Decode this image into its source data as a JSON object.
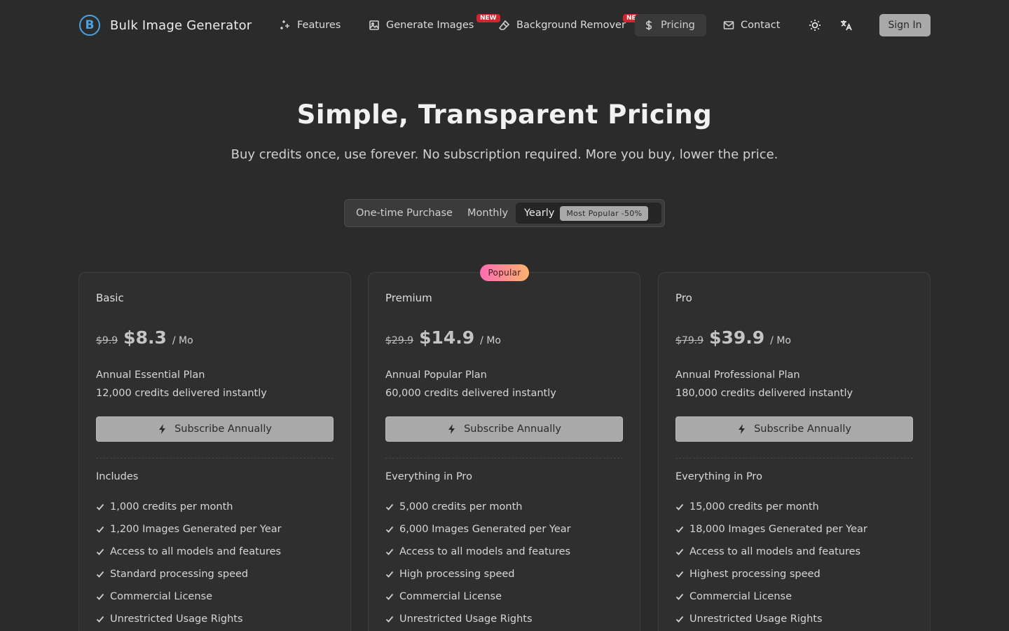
{
  "nav": {
    "brand_letter": "B",
    "brand_name": "Bulk Image Generator",
    "items": [
      {
        "label": "Features",
        "icon": "sparkles-icon"
      },
      {
        "label": "Generate Images",
        "icon": "image-icon",
        "badge": "NEW"
      },
      {
        "label": "Background Remover",
        "icon": "eraser-icon",
        "badge": "NEW"
      },
      {
        "label": "Pricing",
        "icon": "dollar-icon",
        "active": true
      },
      {
        "label": "Contact",
        "icon": "mail-icon"
      }
    ],
    "theme_icon": "sun-icon",
    "language_icon": "translate-icon",
    "signin_label": "Sign In"
  },
  "hero": {
    "title": "Simple, Transparent Pricing",
    "subtitle": "Buy credits once, use forever. No subscription required. More you buy, lower the price."
  },
  "billing_toggle": {
    "options": [
      "One-time Purchase",
      "Monthly",
      "Yearly"
    ],
    "selected": "Yearly",
    "yearly_badge": "Most Popular -50%"
  },
  "popular_label": "Popular",
  "plans": [
    {
      "name": "Basic",
      "old_price": "$9.9",
      "price": "$8.3",
      "per": "/ Mo",
      "description": "Annual Essential Plan",
      "credits": "12,000 credits delivered instantly",
      "cta": "Subscribe Annually",
      "features_heading": "Includes",
      "features": [
        "1,000 credits per month",
        "1,200 Images Generated per Year",
        "Access to all models and features",
        "Standard processing speed",
        "Commercial License",
        "Unrestricted Usage Rights"
      ]
    },
    {
      "name": "Premium",
      "old_price": "$29.9",
      "price": "$14.9",
      "per": "/ Mo",
      "description": "Annual Popular Plan",
      "credits": "60,000 credits delivered instantly",
      "cta": "Subscribe Annually",
      "features_heading": "Everything in Pro",
      "features": [
        "5,000 credits per month",
        "6,000 Images Generated per Year",
        "Access to all models and features",
        "High processing speed",
        "Commercial License",
        "Unrestricted Usage Rights"
      ]
    },
    {
      "name": "Pro",
      "old_price": "$79.9",
      "price": "$39.9",
      "per": "/ Mo",
      "description": "Annual Professional Plan",
      "credits": "180,000 credits delivered instantly",
      "cta": "Subscribe Annually",
      "features_heading": "Everything in Pro",
      "features": [
        "15,000 credits per month",
        "18,000 Images Generated per Year",
        "Access to all models and features",
        "Highest processing speed",
        "Commercial License",
        "Unrestricted Usage Rights"
      ]
    }
  ],
  "colors": {
    "background": "#2b2b2b",
    "brand_blue": "#4aa3e0",
    "new_badge": "#d3252e",
    "button_gray": "#a9a9a9"
  }
}
